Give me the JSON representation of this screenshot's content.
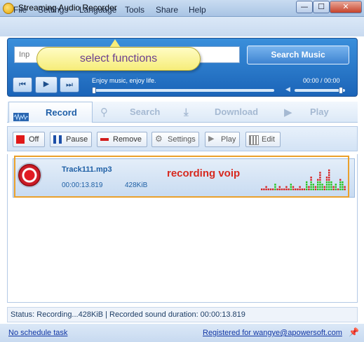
{
  "window": {
    "title": "Streaming Audio Recorder",
    "minimize": "—",
    "maximize": "☐",
    "close": "✕"
  },
  "menu": [
    "File",
    "Settings",
    "Language",
    "Tools",
    "Share",
    "Help"
  ],
  "player": {
    "search_placeholder": "Inp",
    "search_button": "Search Music",
    "tagline": "Enjoy music, enjoy life.",
    "time": "00:00 / 00:00",
    "prev_icon": "prev-icon",
    "play_icon": "play-icon",
    "next_icon": "next-icon"
  },
  "callout": "select functions",
  "tabs": [
    {
      "label": "Record",
      "icon": "waveform-icon",
      "active": true
    },
    {
      "label": "Search",
      "icon": "magnifier-icon",
      "active": false
    },
    {
      "label": "Download",
      "icon": "download-icon",
      "active": false
    },
    {
      "label": "Play",
      "icon": "play-icon",
      "active": false
    }
  ],
  "toolbar": {
    "off": "Off",
    "pause": "Pause",
    "remove": "Remove",
    "settings": "Settings",
    "play": "Play",
    "edit": "Edit"
  },
  "track": {
    "name": "Track111.mp3",
    "duration": "00:00:13.819",
    "size": "428KiB",
    "annotation": "recording voip"
  },
  "status": {
    "text": "Status: Recording...428KiB   |   Recorded sound duration: 00:00:13.819"
  },
  "footer": {
    "schedule": "No schedule task",
    "registered": "Registered for wangye@apowersoft.com"
  },
  "colors": {
    "accent": "#1f5fa8",
    "annotation": "#d7291f",
    "highlight": "#eaa02b",
    "meter_green": "#22c318",
    "meter_red": "#d62020"
  }
}
